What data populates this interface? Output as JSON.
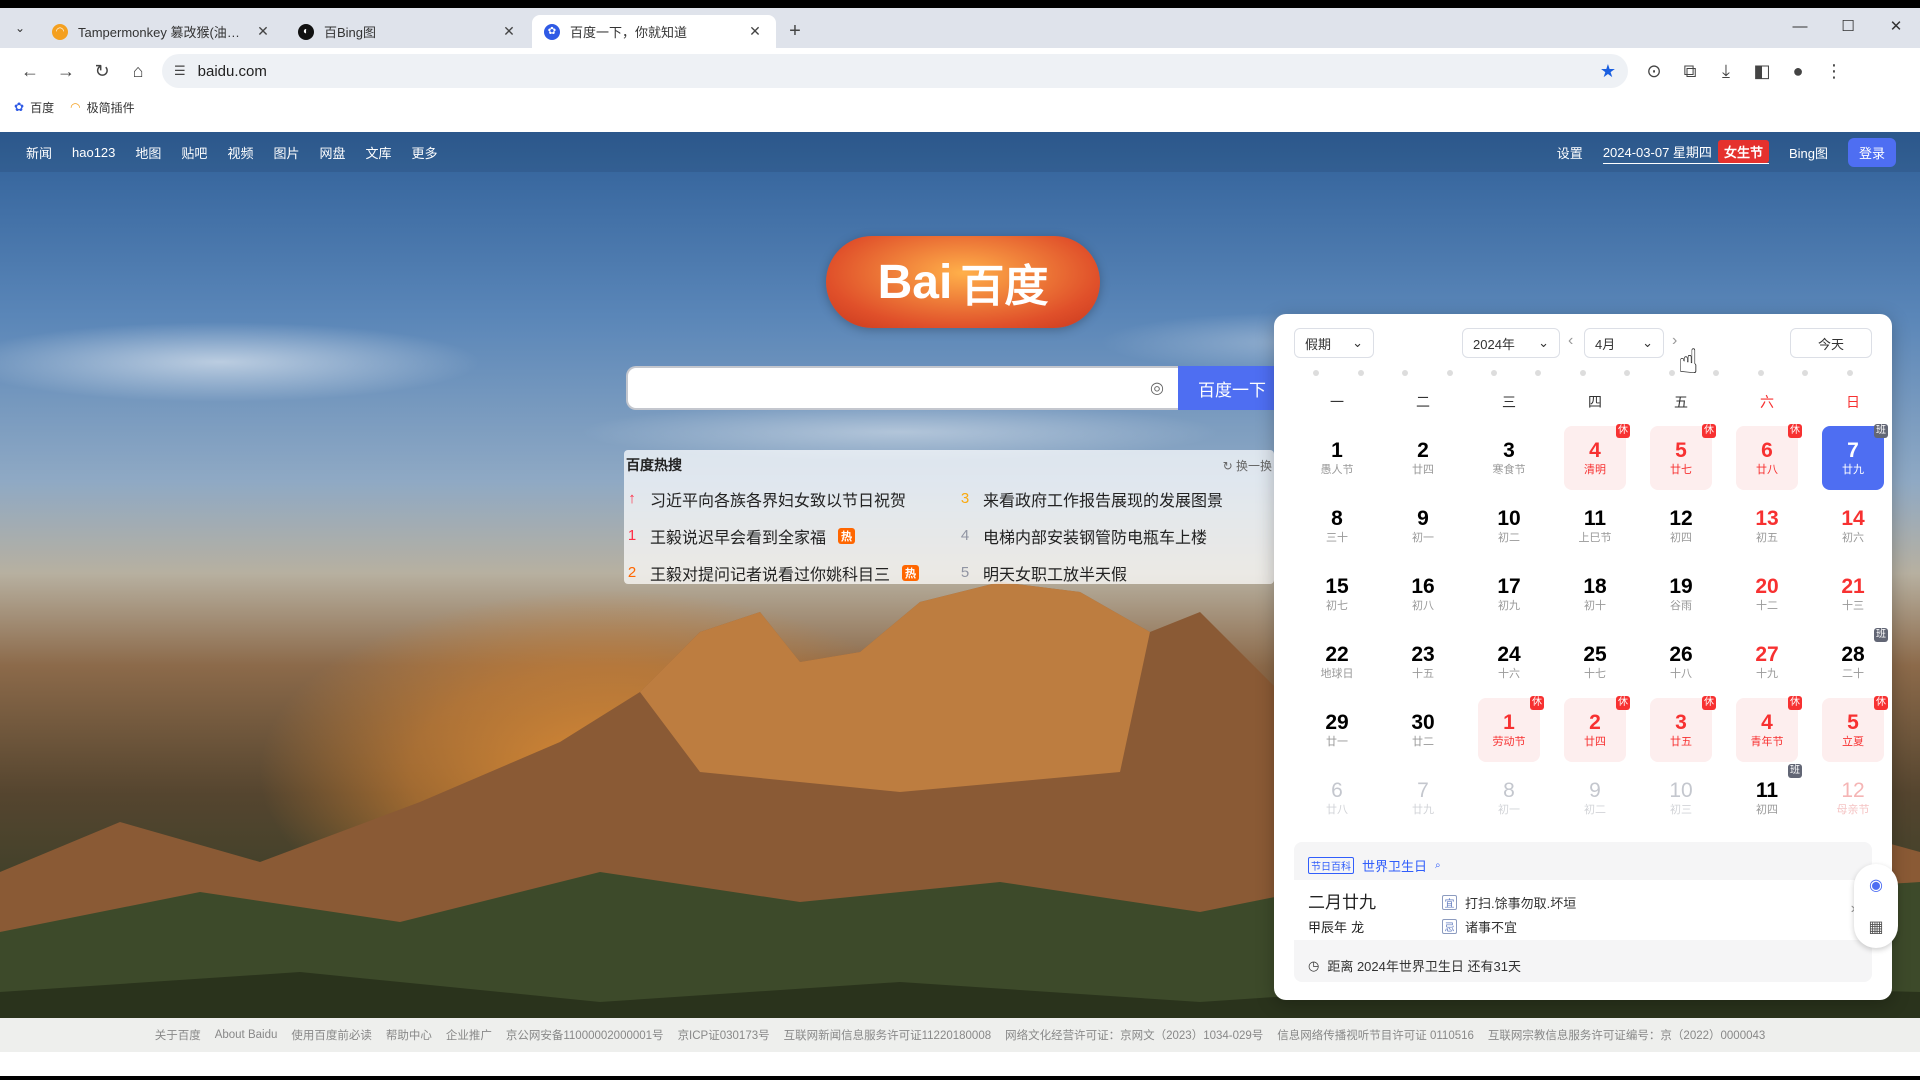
{
  "browser": {
    "tabs": [
      {
        "title": "Tampermonkey 篡改猴(油猴脚本)",
        "active": false
      },
      {
        "title": "百Bing图",
        "active": false
      },
      {
        "title": "百度一下，你就知道",
        "active": true
      }
    ],
    "url": "baidu.com",
    "bookmarks": [
      "百度",
      "极简插件"
    ]
  },
  "nav": {
    "left": [
      "新闻",
      "hao123",
      "地图",
      "贴吧",
      "视频",
      "图片",
      "网盘",
      "文库",
      "更多"
    ],
    "settings": "设置",
    "date": "2024-03-07 星期四",
    "festival": "女生节",
    "bing": "Bing图",
    "login": "登录"
  },
  "logo": {
    "en": "Bai",
    "zh": "百度"
  },
  "search": {
    "button": "百度一下"
  },
  "hot": {
    "title": "百度热搜",
    "change": "换一换",
    "items": [
      {
        "rank": "↑",
        "text": "习近平向各族各界妇女致以节日祝贺",
        "badge": ""
      },
      {
        "rank": "3",
        "text": "来看政府工作报告展现的发展图景",
        "badge": ""
      },
      {
        "rank": "1",
        "text": "王毅说迟早会看到全家福",
        "badge": "热"
      },
      {
        "rank": "4",
        "text": "电梯内部安装钢管防电瓶车上楼",
        "badge": ""
      },
      {
        "rank": "2",
        "text": "王毅对提问记者说看过你姚科目三",
        "badge": "热"
      },
      {
        "rank": "5",
        "text": "明天女职工放半天假",
        "badge": ""
      }
    ]
  },
  "calendar": {
    "holiday_select": "假期",
    "year_select": "2024年",
    "month_select": "4月",
    "today_button": "今天",
    "weekdays": [
      "一",
      "二",
      "三",
      "四",
      "五",
      "六",
      "日"
    ],
    "days": [
      {
        "d": "1",
        "l": "愚人节",
        "type": "",
        "tag": ""
      },
      {
        "d": "2",
        "l": "廿四",
        "type": "",
        "tag": ""
      },
      {
        "d": "3",
        "l": "寒食节",
        "type": "",
        "tag": ""
      },
      {
        "d": "4",
        "l": "清明",
        "type": "hol",
        "tag": "休"
      },
      {
        "d": "5",
        "l": "廿七",
        "type": "hol",
        "tag": "休"
      },
      {
        "d": "6",
        "l": "廿八",
        "type": "hol",
        "tag": "休"
      },
      {
        "d": "7",
        "l": "廿九",
        "type": "today",
        "tag": "班"
      },
      {
        "d": "8",
        "l": "三十",
        "type": "",
        "tag": ""
      },
      {
        "d": "9",
        "l": "初一",
        "type": "",
        "tag": ""
      },
      {
        "d": "10",
        "l": "初二",
        "type": "",
        "tag": ""
      },
      {
        "d": "11",
        "l": "上巳节",
        "type": "",
        "tag": ""
      },
      {
        "d": "12",
        "l": "初四",
        "type": "",
        "tag": ""
      },
      {
        "d": "13",
        "l": "初五",
        "type": "we",
        "tag": ""
      },
      {
        "d": "14",
        "l": "初六",
        "type": "we",
        "tag": ""
      },
      {
        "d": "15",
        "l": "初七",
        "type": "",
        "tag": ""
      },
      {
        "d": "16",
        "l": "初八",
        "type": "",
        "tag": ""
      },
      {
        "d": "17",
        "l": "初九",
        "type": "",
        "tag": ""
      },
      {
        "d": "18",
        "l": "初十",
        "type": "",
        "tag": ""
      },
      {
        "d": "19",
        "l": "谷雨",
        "type": "",
        "tag": ""
      },
      {
        "d": "20",
        "l": "十二",
        "type": "we",
        "tag": ""
      },
      {
        "d": "21",
        "l": "十三",
        "type": "we",
        "tag": ""
      },
      {
        "d": "22",
        "l": "地球日",
        "type": "",
        "tag": ""
      },
      {
        "d": "23",
        "l": "十五",
        "type": "",
        "tag": ""
      },
      {
        "d": "24",
        "l": "十六",
        "type": "",
        "tag": ""
      },
      {
        "d": "25",
        "l": "十七",
        "type": "",
        "tag": ""
      },
      {
        "d": "26",
        "l": "十八",
        "type": "",
        "tag": ""
      },
      {
        "d": "27",
        "l": "十九",
        "type": "we",
        "tag": ""
      },
      {
        "d": "28",
        "l": "二十",
        "type": "",
        "tag": "班"
      },
      {
        "d": "29",
        "l": "廿一",
        "type": "",
        "tag": ""
      },
      {
        "d": "30",
        "l": "廿二",
        "type": "",
        "tag": ""
      },
      {
        "d": "1",
        "l": "劳动节",
        "type": "hol",
        "tag": "休"
      },
      {
        "d": "2",
        "l": "廿四",
        "type": "hol",
        "tag": "休"
      },
      {
        "d": "3",
        "l": "廿五",
        "type": "hol",
        "tag": "休"
      },
      {
        "d": "4",
        "l": "青年节",
        "type": "hol",
        "tag": "休"
      },
      {
        "d": "5",
        "l": "立夏",
        "type": "hol",
        "tag": "休"
      },
      {
        "d": "6",
        "l": "廿八",
        "type": "other",
        "tag": ""
      },
      {
        "d": "7",
        "l": "廿九",
        "type": "other",
        "tag": ""
      },
      {
        "d": "8",
        "l": "初一",
        "type": "other",
        "tag": ""
      },
      {
        "d": "9",
        "l": "初二",
        "type": "other",
        "tag": ""
      },
      {
        "d": "10",
        "l": "初三",
        "type": "other",
        "tag": ""
      },
      {
        "d": "11",
        "l": "初四",
        "type": "",
        "tag": "班"
      },
      {
        "d": "12",
        "l": "母亲节",
        "type": "other we",
        "tag": ""
      }
    ],
    "festival_tag": "节日百科",
    "festival_name": "世界卫生日",
    "lunar_date": "二月廿九",
    "ganzhi": "甲辰年 龙",
    "yi_label": "宜",
    "yi": "打扫.馀事勿取.坏垣",
    "ji_label": "忌",
    "ji": "诸事不宜",
    "countdown": "距离 2024年世界卫生日 还有31天"
  },
  "footer": [
    "关于百度",
    "About Baidu",
    "使用百度前必读",
    "帮助中心",
    "企业推广",
    "京公网安备11000002000001号",
    "京ICP证030173号",
    "互联网新闻信息服务许可证11220180008",
    "网络文化经营许可证：京网文（2023）1034-029号",
    "信息网络传播视听节目许可证 0110516",
    "互联网宗教信息服务许可证编号：京（2022）0000043"
  ]
}
